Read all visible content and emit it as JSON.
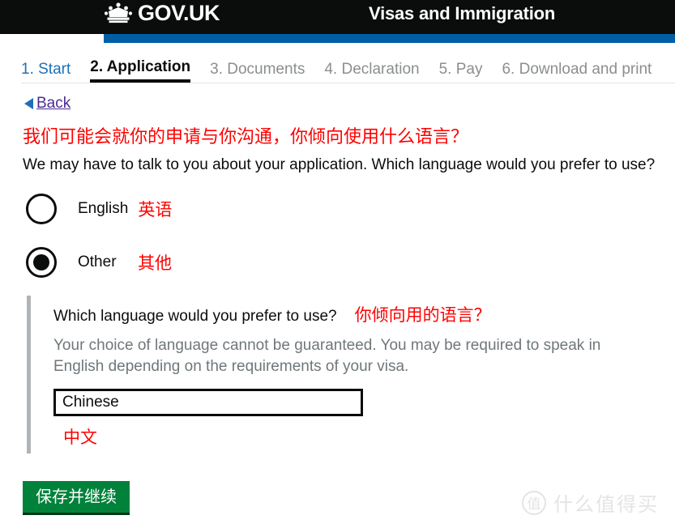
{
  "header": {
    "brand_name": "GOV.UK",
    "crown_icon": "crown-icon",
    "service_name": "Visas and Immigration",
    "colors": {
      "header_bg": "#0b0c0c",
      "accent_blue": "#005ea5"
    }
  },
  "step_nav": {
    "steps": [
      {
        "label": "1. Start",
        "state": "link"
      },
      {
        "label": "2. Application",
        "state": "active"
      },
      {
        "label": "3. Documents",
        "state": "muted"
      },
      {
        "label": "4. Declaration",
        "state": "muted"
      },
      {
        "label": "5. Pay",
        "state": "muted"
      },
      {
        "label": "6. Download and print",
        "state": "muted"
      }
    ]
  },
  "back_link": {
    "label": "Back",
    "icon": "triangle-left-icon"
  },
  "question": {
    "heading_cn": "我们可能会就你的申请与你沟通，你倾向使用什么语言？",
    "subheading_en": "We may have to talk to you about your application. Which language would you prefer to use?"
  },
  "radios": [
    {
      "label_en": "English",
      "label_cn": "英语",
      "checked": false
    },
    {
      "label_en": "Other",
      "label_cn": "其他",
      "checked": true
    }
  ],
  "panel": {
    "label_en": "Which language would you prefer to use?",
    "label_cn": "你倾向用的语言？",
    "hint": "Your choice of language cannot be guaranteed. You may be required to speak in English depending on the requirements of your visa.",
    "input_value": "Chinese",
    "input_placeholder": "",
    "input_note_cn": "中文"
  },
  "submit": {
    "label": "保存并继续",
    "color": "#00823b"
  },
  "watermark": {
    "logo_text": "值",
    "text": "什么值得买",
    "color": "#e4e4e4"
  }
}
